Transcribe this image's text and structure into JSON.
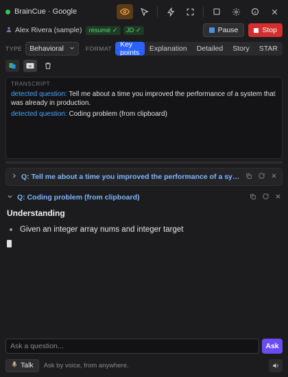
{
  "app": {
    "title": "BrainCue · Google"
  },
  "profile": {
    "user": "Alex Rivera (sample)",
    "chips": [
      "résumé ✓",
      "JD ✓"
    ],
    "pause_label": "Pause",
    "stop_label": "Stop"
  },
  "controls": {
    "type_label": "TYPE",
    "type_value": "Behavioral",
    "format_label": "FORMAT",
    "formats": [
      "Key points",
      "Explanation",
      "Detailed",
      "Story",
      "STAR"
    ],
    "active_format": "Key points"
  },
  "transcript": {
    "label": "TRANSCRIPT",
    "entries": [
      {
        "tag": "detected question:",
        "text": " Tell me about a time you improved the performance of a system that was already in production."
      },
      {
        "tag": "detected question:",
        "text": " Coding problem (from clipboard)"
      }
    ]
  },
  "questions": [
    {
      "title": "Q: Tell me about a time you improved the performance of a system that was already in production.",
      "collapsed": true
    },
    {
      "title": "Q: Coding problem (from clipboard)",
      "collapsed": false
    }
  ],
  "answer": {
    "section": "Understanding",
    "bullets": [
      "Given an integer array nums and integer target"
    ]
  },
  "ask": {
    "placeholder": "Ask a question...",
    "button_label": "Ask"
  },
  "talk": {
    "label": "Talk",
    "hint": "Ask by voice, from anywhere."
  },
  "colors": {
    "accent": "#2962ff",
    "stop": "#d32f2f",
    "ask": "#6a4df2",
    "question": "#7db8ff",
    "status": "#34c759"
  }
}
